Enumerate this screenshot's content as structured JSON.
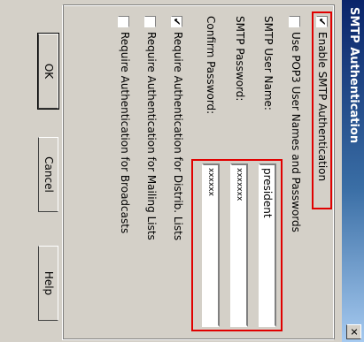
{
  "window": {
    "title": "SMTP Authentication",
    "close_glyph": "✕"
  },
  "options": {
    "enable_smtp_auth": {
      "label": "Enable SMTP Authentication",
      "checked": true
    },
    "use_pop3_names": {
      "label": "Use POP3 User Names and Passwords",
      "checked": false
    },
    "require_distrib": {
      "label": "Require Authentication for Distrib. Lists",
      "checked": true
    },
    "require_mailing": {
      "label": "Require Authentication for Mailing Lists",
      "checked": false
    },
    "require_broadcasts": {
      "label": "Require Authentication for Broadcasts",
      "checked": false
    }
  },
  "fields": {
    "user_name": {
      "label": "SMTP User Name:",
      "value": "president"
    },
    "password": {
      "label": "SMTP Password:",
      "value": "xxxxxxx"
    },
    "confirm": {
      "label": "Confirm Password:",
      "value": "xxxxxx"
    }
  },
  "buttons": {
    "ok": "OK",
    "cancel": "Cancel",
    "help": "Help"
  },
  "colors": {
    "title_bar": "#0a246a",
    "highlight": "#e00000",
    "dialog_bg": "#d4d0c8"
  }
}
